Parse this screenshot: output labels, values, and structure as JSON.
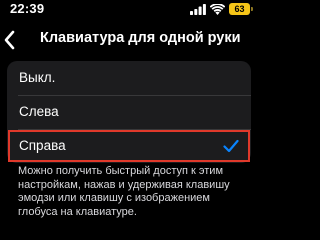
{
  "status_bar": {
    "time": "22:39",
    "battery_level": "63",
    "battery_color": "#f5c518",
    "icons": [
      "signal-icon",
      "wifi-icon",
      "battery-icon"
    ]
  },
  "nav": {
    "back_icon": "chevron-left-icon",
    "title": "Клавиатура для одной руки"
  },
  "options": [
    {
      "label": "Выкл.",
      "selected": false
    },
    {
      "label": "Слева",
      "selected": false
    },
    {
      "label": "Справа",
      "selected": true
    }
  ],
  "highlight_color": "#e0392b",
  "checkmark_color": "#0a84ff",
  "footer": {
    "text": "Можно получить быстрый доступ к этим настройкам, нажав и удерживая клавишу эмодзи или клавишу с изображением глобуса на клавиатуре."
  }
}
